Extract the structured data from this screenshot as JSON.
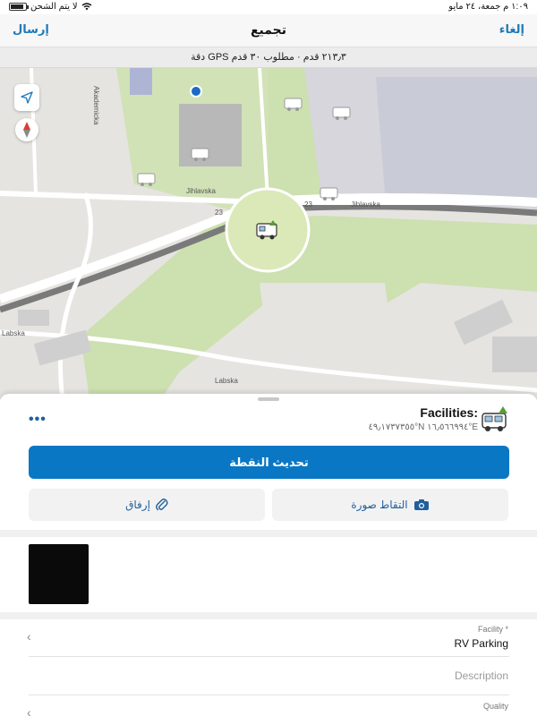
{
  "status_bar": {
    "time": "١:٠٩ م  جمعة، ٢٤ مايو",
    "charging": "لا يتم الشحن"
  },
  "nav": {
    "title": "تجميع",
    "send_label": "إرسال",
    "cancel_label": "إلغاء"
  },
  "gps_bar": "دقة GPS ‏٢١٣٫٣ قدم · مطلوب ٣٠ قدم",
  "map": {
    "streets": [
      "Jihlavska",
      "Jihlavska",
      "Labska",
      "Labska",
      "Akademicka"
    ],
    "road_number": "23"
  },
  "feature": {
    "title": "Facilities:",
    "coords": "٤٩٫١٧٣٧٣٥٥°N  ١٦٫٥٦٦٩٩٤°E",
    "more_label": "•••"
  },
  "actions": {
    "update_label": "تحديث النقطة",
    "photo_label": "التقاط صورة",
    "attach_label": "إرفاق"
  },
  "fields": [
    {
      "label": "Facility *",
      "value": "RV Parking"
    },
    {
      "label": "",
      "placeholder": "Description"
    },
    {
      "label": "Quality",
      "value": ""
    }
  ],
  "icons": {
    "locate": "location-arrow-icon",
    "compass": "compass-icon",
    "camera": "camera-icon",
    "paperclip": "paperclip-icon",
    "chevron": "chevron-left-icon",
    "rv": "rv-icon"
  },
  "colors": {
    "accent": "#0a77c4",
    "link": "#1f7ab8",
    "park_green": "#cde0b0",
    "buffer_fill": "#dbe8b8"
  }
}
